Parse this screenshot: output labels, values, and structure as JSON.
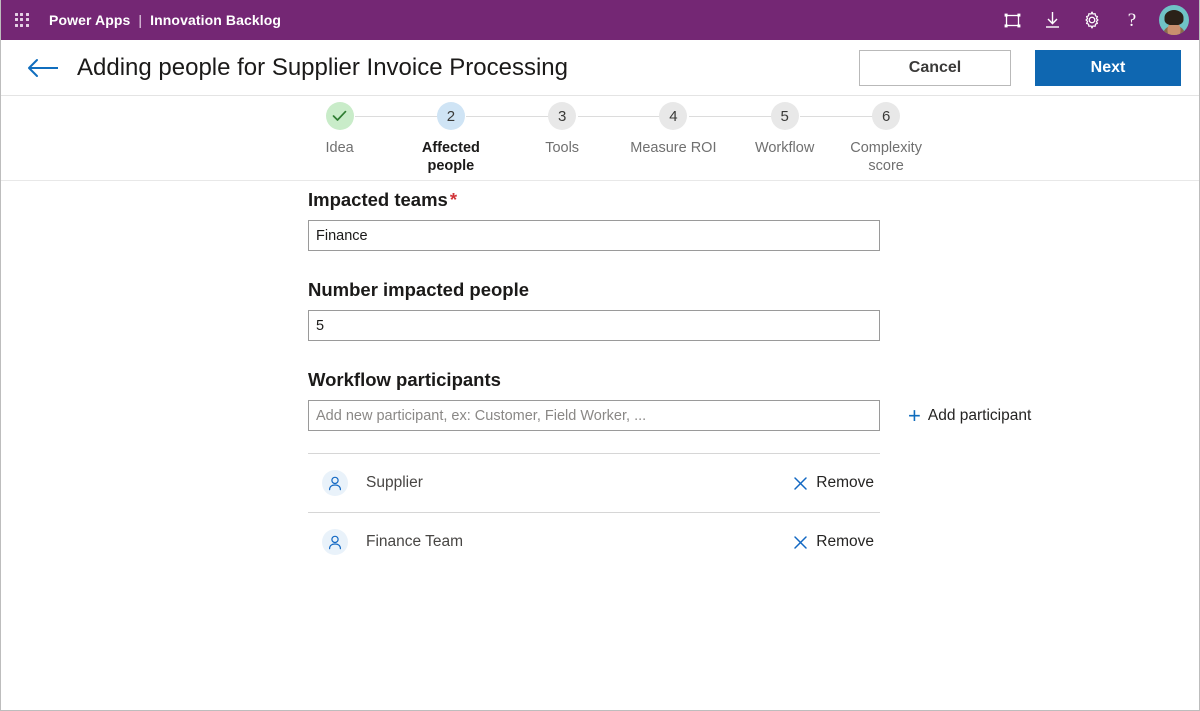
{
  "topbar": {
    "waffle_icon": "app-launcher-grid-icon",
    "product": "Power Apps",
    "separator": "|",
    "app_name": "Innovation Backlog",
    "icons": [
      {
        "name": "fit-to-screen-icon",
        "glyph": "frame"
      },
      {
        "name": "download-icon",
        "glyph": "download"
      },
      {
        "name": "settings-gear-icon",
        "glyph": "gear"
      },
      {
        "name": "help-icon",
        "glyph": "?"
      }
    ],
    "avatar_label": "user-avatar",
    "bg_color": "#742774"
  },
  "header": {
    "back_icon": "back-arrow-icon",
    "title": "Adding people for Supplier Invoice Processing",
    "cancel_label": "Cancel",
    "next_label": "Next",
    "next_bg": "#0f67b1"
  },
  "stepper": {
    "steps": [
      {
        "num": "✓",
        "label": "Idea",
        "state": "done",
        "color": "#c9ecc9"
      },
      {
        "num": "2",
        "label": "Affected people",
        "state": "active",
        "color": "#cfe4f5"
      },
      {
        "num": "3",
        "label": "Tools",
        "state": "todo",
        "color": "#e8e8e8"
      },
      {
        "num": "4",
        "label": "Measure ROI",
        "state": "todo",
        "color": "#e8e8e8"
      },
      {
        "num": "5",
        "label": "Workflow",
        "state": "todo",
        "color": "#e8e8e8"
      },
      {
        "num": "6",
        "label": "Complexity score",
        "state": "todo",
        "color": "#e8e8e8"
      }
    ]
  },
  "form": {
    "impacted_teams": {
      "label": "Impacted teams",
      "required_mark": "*",
      "value": "Finance",
      "placeholder": ""
    },
    "number_impacted_people": {
      "label": "Number impacted people",
      "value": "5",
      "placeholder": ""
    },
    "workflow_participants": {
      "label": "Workflow participants",
      "input_value": "",
      "placeholder": "Add new participant, ex: Customer, Field Worker, ...",
      "add_label": "Add participant",
      "add_icon": "plus-icon",
      "remove_label": "Remove",
      "remove_icon": "close-x-icon",
      "person_icon": "person-icon",
      "items": [
        {
          "name": "Supplier"
        },
        {
          "name": "Finance Team"
        }
      ]
    }
  }
}
